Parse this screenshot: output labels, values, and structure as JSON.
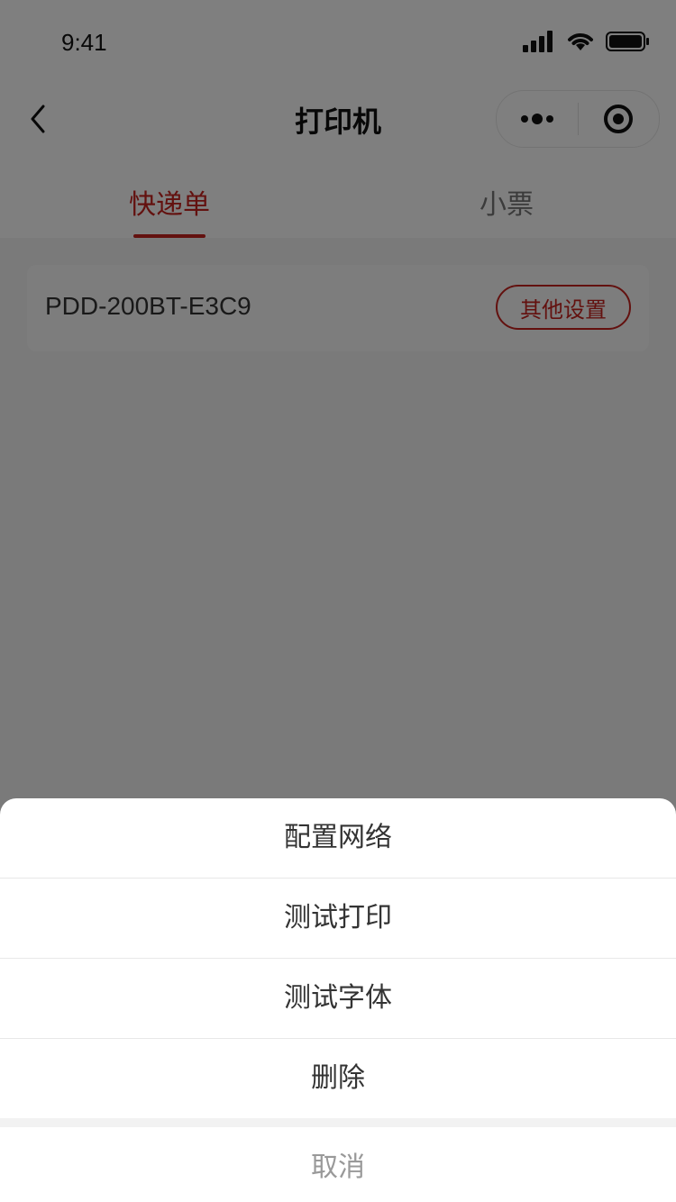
{
  "status_bar": {
    "time": "9:41",
    "signal_icon": "signal-bars-icon",
    "wifi_icon": "wifi-icon",
    "battery_icon": "battery-icon"
  },
  "nav": {
    "title": "打印机",
    "back_icon": "chevron-left-icon",
    "more_icon": "more-dots-icon",
    "close_icon": "target-circle-icon"
  },
  "tabs": [
    {
      "label": "快递单",
      "active": true
    },
    {
      "label": "小票",
      "active": false
    }
  ],
  "printer": {
    "name": "PDD-200BT-E3C9",
    "settings_button": "其他设置"
  },
  "action_sheet": {
    "items": [
      "配置网络",
      "测试打印",
      "测试字体",
      "删除"
    ],
    "cancel": "取消"
  },
  "colors": {
    "accent": "#c7221e",
    "mask": "rgba(0,0,0,0.5)"
  }
}
